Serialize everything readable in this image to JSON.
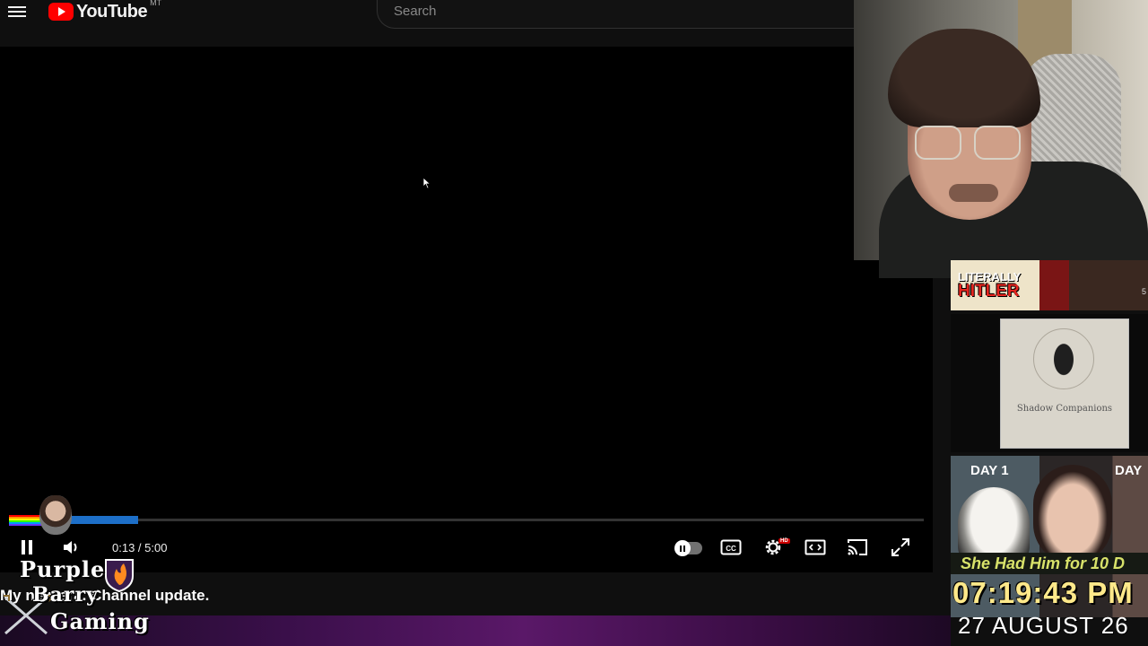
{
  "header": {
    "logo_text": "YouTube",
    "logo_region": "MT",
    "search_placeholder": "Search"
  },
  "player": {
    "time_current": "0:13",
    "time_separator": " / ",
    "time_total": "5:00",
    "progress_fraction": 0.043,
    "overlay_title": "My new era. Channel update.",
    "channel_logo": {
      "line1": "Purple",
      "line2": "Barry",
      "line3": "Gaming"
    }
  },
  "sidebar": {
    "thumb1": {
      "line1": "LITERALLY",
      "line2": "HITLER",
      "side_num": "5"
    },
    "thumb2": {
      "text": "Shadow Companions"
    },
    "thumb3": {
      "day_left": "DAY 1",
      "day_right": "DAY",
      "title": "She Had Him for 10 D"
    }
  },
  "stream_overlay": {
    "clock": "07:19:43 PM",
    "date": "27 AUGUST 26"
  },
  "colors": {
    "accent_red": "#ff0000",
    "progress_blue": "#1d6fc8",
    "clock_yellow": "#ffe98a"
  },
  "icons": [
    "menu-icon",
    "pause-icon",
    "volume-icon",
    "autoplay-toggle",
    "captions-icon",
    "settings-icon",
    "theater-icon",
    "cast-icon",
    "fullscreen-icon"
  ]
}
